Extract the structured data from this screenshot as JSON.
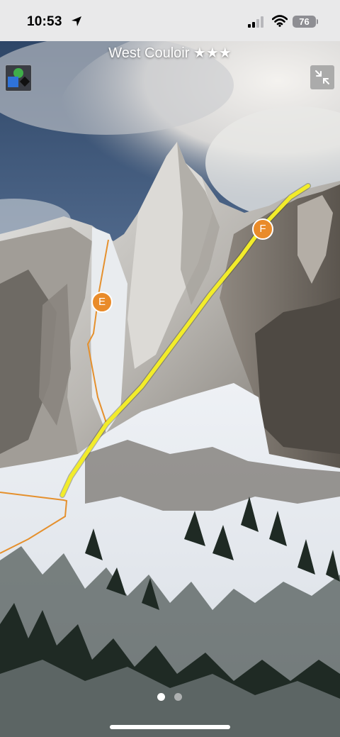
{
  "status_bar": {
    "time": "10:53",
    "battery": "76"
  },
  "route": {
    "title": "West Couloir ★★★"
  },
  "markers": {
    "e_label": "E",
    "f_label": "F"
  },
  "pager": {
    "pages": 2,
    "active_page": 1
  },
  "colors": {
    "route_highlight": "#f2ec2a",
    "route_lines": "#e5902d",
    "marker_fill": "#e98b2a"
  }
}
